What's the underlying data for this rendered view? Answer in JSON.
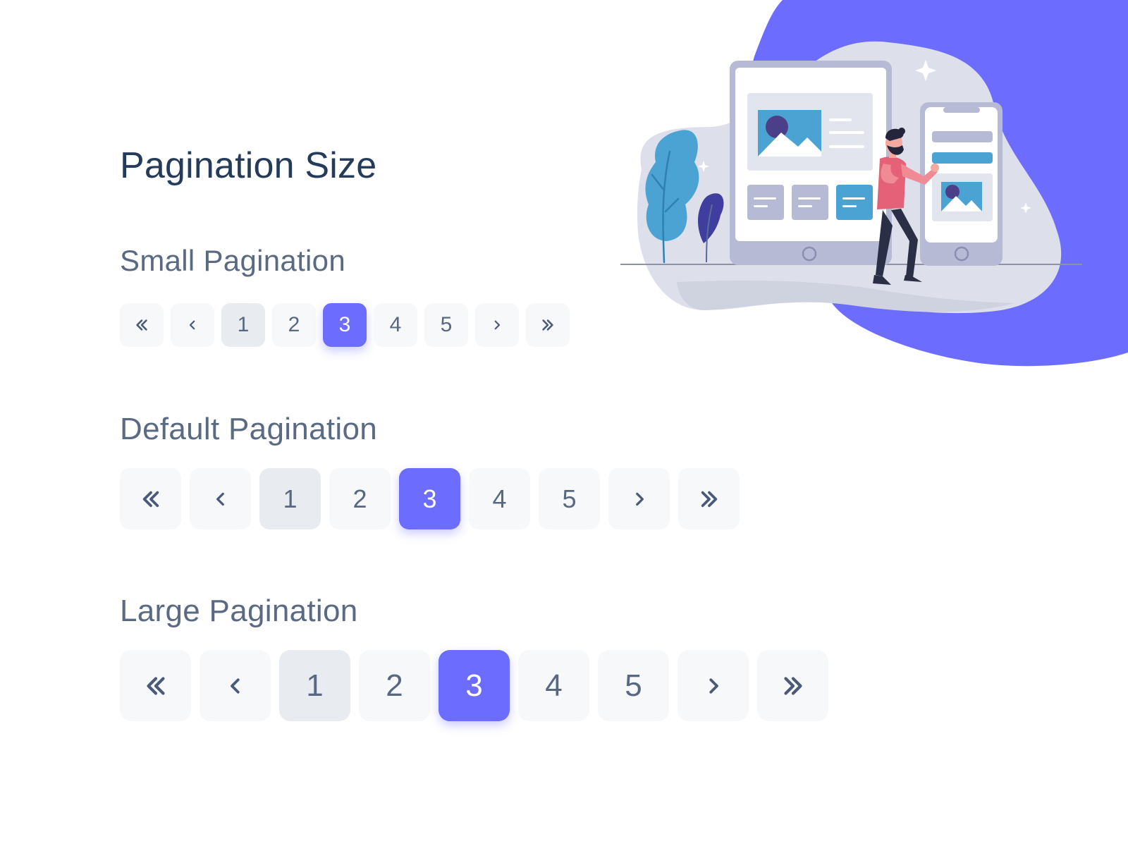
{
  "page": {
    "title": "Pagination Size"
  },
  "sections": {
    "small": {
      "title": "Small Pagination",
      "pages": [
        "1",
        "2",
        "3",
        "4",
        "5"
      ],
      "active_page": "3",
      "current_page": "1"
    },
    "default": {
      "title": "Default Pagination",
      "pages": [
        "1",
        "2",
        "3",
        "4",
        "5"
      ],
      "active_page": "3",
      "current_page": "1"
    },
    "large": {
      "title": "Large Pagination",
      "pages": [
        "1",
        "2",
        "3",
        "4",
        "5"
      ],
      "active_page": "3",
      "current_page": "1"
    }
  },
  "icons": {
    "first": "double-chevron-left-icon",
    "prev": "chevron-left-icon",
    "next": "chevron-right-icon",
    "last": "double-chevron-right-icon"
  },
  "colors": {
    "accent": "#6c6cff",
    "title": "#243b5a",
    "label": "#5a6a82",
    "button_bg": "#f7f8fa",
    "current_bg": "#e8ebef"
  }
}
